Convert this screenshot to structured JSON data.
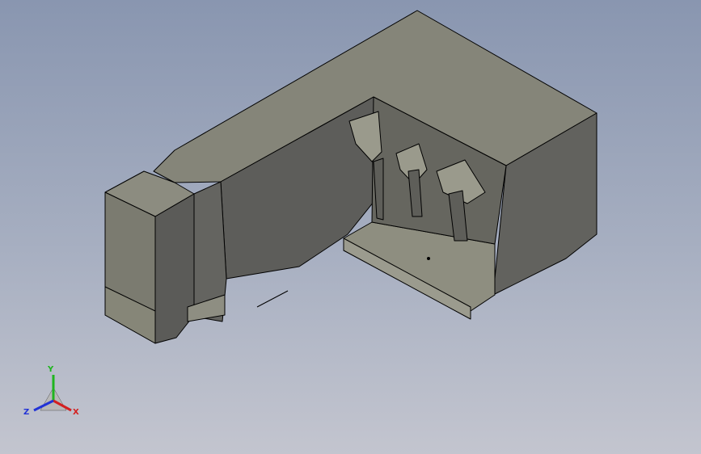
{
  "viewport": {
    "background_top": "#8996b0",
    "background_bottom": "#c3c5cf"
  },
  "model": {
    "face_top": "#858579",
    "face_front": "#5a5a57",
    "face_side": "#6e6e67",
    "face_light": "#8e8e82",
    "edge": "#000000"
  },
  "triad": {
    "x_label": "X",
    "y_label": "Y",
    "z_label": "Z",
    "x_color": "#d32020",
    "y_color": "#1fb51f",
    "z_color": "#2233d6"
  }
}
